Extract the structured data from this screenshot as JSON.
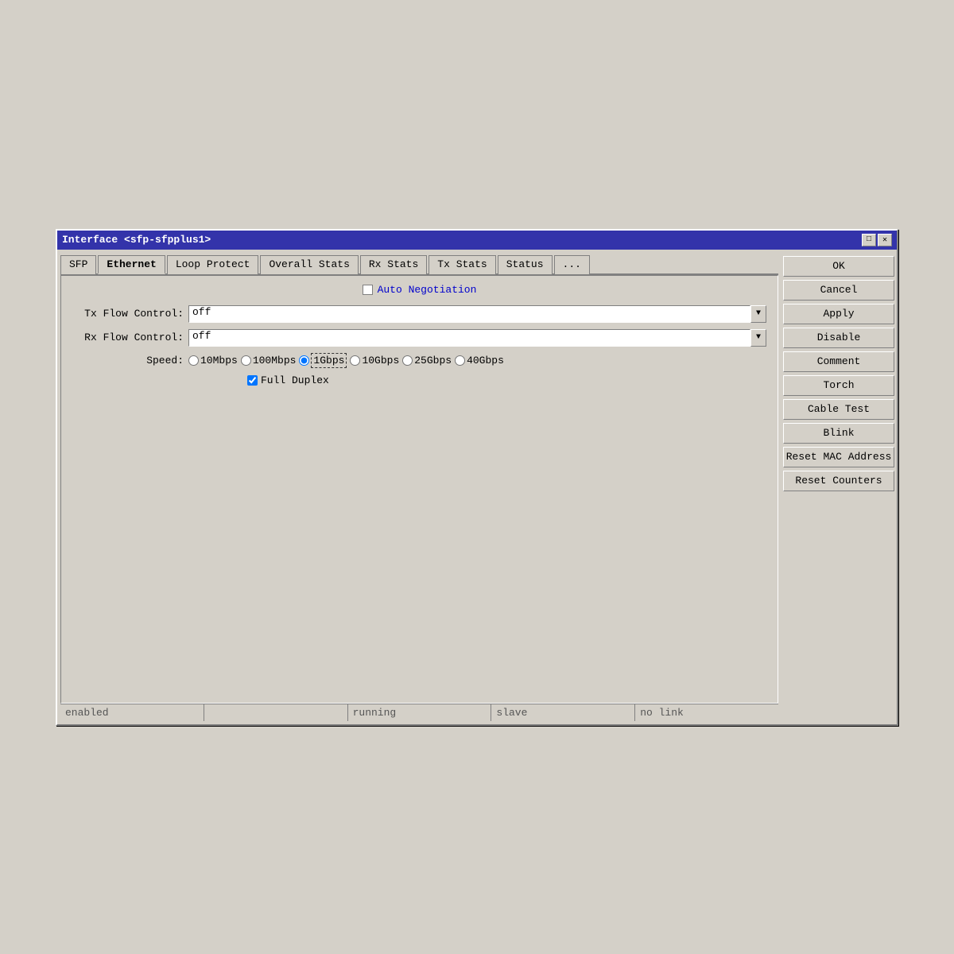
{
  "window": {
    "title": "Interface <sfp-sfpplus1>",
    "title_buttons": [
      "□",
      "✕"
    ]
  },
  "tabs": [
    {
      "id": "sfp",
      "label": "SFP",
      "active": false
    },
    {
      "id": "ethernet",
      "label": "Ethernet",
      "active": true
    },
    {
      "id": "loop-protect",
      "label": "Loop Protect",
      "active": false
    },
    {
      "id": "overall-stats",
      "label": "Overall Stats",
      "active": false
    },
    {
      "id": "rx-stats",
      "label": "Rx Stats",
      "active": false
    },
    {
      "id": "tx-stats",
      "label": "Tx Stats",
      "active": false
    },
    {
      "id": "status",
      "label": "Status",
      "active": false
    },
    {
      "id": "more",
      "label": "...",
      "active": false
    }
  ],
  "form": {
    "auto_negotiation_label": "Auto Negotiation",
    "auto_negotiation_checked": false,
    "tx_flow_control_label": "Tx Flow Control:",
    "tx_flow_control_value": "off",
    "rx_flow_control_label": "Rx Flow Control:",
    "rx_flow_control_value": "off",
    "speed_label": "Speed:",
    "speed_options": [
      {
        "value": "10Mbps",
        "label": "10Mbps",
        "selected": false
      },
      {
        "value": "100Mbps",
        "label": "100Mbps",
        "selected": false
      },
      {
        "value": "1Gbps",
        "label": "1Gbps",
        "selected": true
      },
      {
        "value": "10Gbps",
        "label": "10Gbps",
        "selected": false
      },
      {
        "value": "25Gbps",
        "label": "25Gbps",
        "selected": false
      },
      {
        "value": "40Gbps",
        "label": "40Gbps",
        "selected": false
      }
    ],
    "full_duplex_label": "Full Duplex",
    "full_duplex_checked": true
  },
  "buttons": {
    "ok": "OK",
    "cancel": "Cancel",
    "apply": "Apply",
    "disable": "Disable",
    "comment": "Comment",
    "torch": "Torch",
    "cable_test": "Cable Test",
    "blink": "Blink",
    "reset_mac": "Reset MAC Address",
    "reset_counters": "Reset Counters"
  },
  "status_bar": {
    "status1": "enabled",
    "status2": "",
    "status3": "running",
    "status4": "slave",
    "status5": "no link"
  }
}
